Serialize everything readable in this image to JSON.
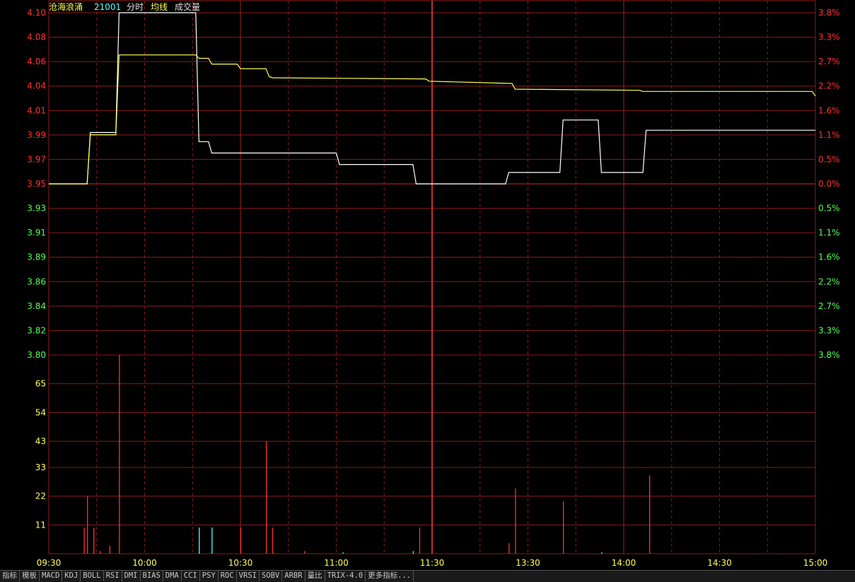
{
  "header": {
    "stock_name": "沧海浪涌",
    "stock_code": "21001",
    "label_timeshare": "分时",
    "label_avg": "均线",
    "label_volume": "成交量"
  },
  "colors": {
    "grid": "#8b1a1a",
    "price_line": "#ffffff",
    "avg_line": "#ffff55",
    "up": "#ff3232",
    "down": "#54ff54",
    "volume_axis": "#ffff55",
    "up_volume": "#ff3232",
    "down_volume": "#55ffff",
    "name": "#ffff55",
    "code": "#55ffff"
  },
  "toolbar": {
    "items": [
      "指标",
      "模板",
      "MACD",
      "KDJ",
      "BOLL",
      "RSI",
      "DMI",
      "BIAS",
      "DMA",
      "CCI",
      "PSY",
      "ROC",
      "VRSI",
      "SOBV",
      "ARBR",
      "量比",
      "TRIX-4.0",
      "更多指标..."
    ]
  },
  "chart_data": [
    {
      "type": "line",
      "name": "price",
      "prev_close": 3.95,
      "ylim": [
        3.8,
        4.1
      ],
      "y_ticks_left": [
        "4.10",
        "4.08",
        "4.06",
        "4.04",
        "4.01",
        "3.99",
        "3.97",
        "3.95",
        "3.93",
        "3.91",
        "3.89",
        "3.86",
        "3.84",
        "3.82",
        "3.80"
      ],
      "y_ticks_right": [
        "3.8%",
        "3.3%",
        "2.7%",
        "2.2%",
        "1.6%",
        "1.1%",
        "0.5%",
        "0.0%",
        "0.5%",
        "1.1%",
        "1.6%",
        "2.2%",
        "2.7%",
        "3.3%",
        "3.8%"
      ],
      "x_ticks": [
        "09:30",
        "10:00",
        "10:30",
        "11:00",
        "11:30",
        "13:30",
        "14:00",
        "14:30",
        "15:00"
      ],
      "series": [
        {
          "key": "price",
          "points": [
            [
              0,
              3.95
            ],
            [
              12,
              3.95
            ],
            [
              13,
              3.995
            ],
            [
              21,
              3.995
            ],
            [
              22,
              4.1
            ],
            [
              46,
              4.1
            ],
            [
              47,
              3.987
            ],
            [
              50,
              3.987
            ],
            [
              51,
              3.977
            ],
            [
              90,
              3.977
            ],
            [
              91,
              3.967
            ],
            [
              114,
              3.967
            ],
            [
              115,
              3.95
            ],
            [
              143,
              3.95
            ],
            [
              144,
              3.96
            ],
            [
              160,
              3.96
            ],
            [
              161,
              4.006
            ],
            [
              172,
              4.006
            ],
            [
              173,
              3.96
            ],
            [
              186,
              3.96
            ],
            [
              187,
              3.997
            ],
            [
              240,
              3.997
            ]
          ]
        },
        {
          "key": "avg",
          "points": [
            [
              0,
              3.95
            ],
            [
              12,
              3.95
            ],
            [
              13,
              3.993
            ],
            [
              21,
              3.993
            ],
            [
              22,
              4.063
            ],
            [
              46,
              4.063
            ],
            [
              47,
              4.06
            ],
            [
              50,
              4.06
            ],
            [
              51,
              4.055
            ],
            [
              59,
              4.055
            ],
            [
              60,
              4.051
            ],
            [
              68,
              4.051
            ],
            [
              69,
              4.044
            ],
            [
              70,
              4.043
            ],
            [
              118,
              4.042
            ],
            [
              119,
              4.04
            ],
            [
              145,
              4.038
            ],
            [
              146,
              4.033
            ],
            [
              185,
              4.032
            ],
            [
              186,
              4.031
            ],
            [
              239,
              4.031
            ],
            [
              240,
              4.027
            ]
          ]
        }
      ]
    },
    {
      "type": "bar",
      "name": "volume",
      "ylim": [
        0,
        76
      ],
      "y_ticks": [
        "65",
        "54",
        "43",
        "33",
        "22",
        "11"
      ],
      "bars": [
        {
          "t": 11,
          "v": 10,
          "dir": "up"
        },
        {
          "t": 12,
          "v": 22,
          "dir": "up"
        },
        {
          "t": 14,
          "v": 10,
          "dir": "up"
        },
        {
          "t": 16,
          "v": 1,
          "dir": "up"
        },
        {
          "t": 19,
          "v": 3,
          "dir": "up"
        },
        {
          "t": 22,
          "v": 76,
          "dir": "up"
        },
        {
          "t": 47,
          "v": 10,
          "dir": "down"
        },
        {
          "t": 51,
          "v": 10,
          "dir": "down"
        },
        {
          "t": 60,
          "v": 10,
          "dir": "up"
        },
        {
          "t": 68,
          "v": 43,
          "dir": "up"
        },
        {
          "t": 70,
          "v": 10,
          "dir": "up"
        },
        {
          "t": 80,
          "v": 1,
          "dir": "up"
        },
        {
          "t": 92,
          "v": 0.5,
          "dir": "down"
        },
        {
          "t": 114,
          "v": 1,
          "dir": "down"
        },
        {
          "t": 116,
          "v": 10,
          "dir": "up"
        },
        {
          "t": 144,
          "v": 4,
          "dir": "up"
        },
        {
          "t": 146,
          "v": 25,
          "dir": "up"
        },
        {
          "t": 161,
          "v": 20,
          "dir": "up"
        },
        {
          "t": 173,
          "v": 0.5,
          "dir": "down"
        },
        {
          "t": 188,
          "v": 30,
          "dir": "up"
        }
      ]
    }
  ]
}
